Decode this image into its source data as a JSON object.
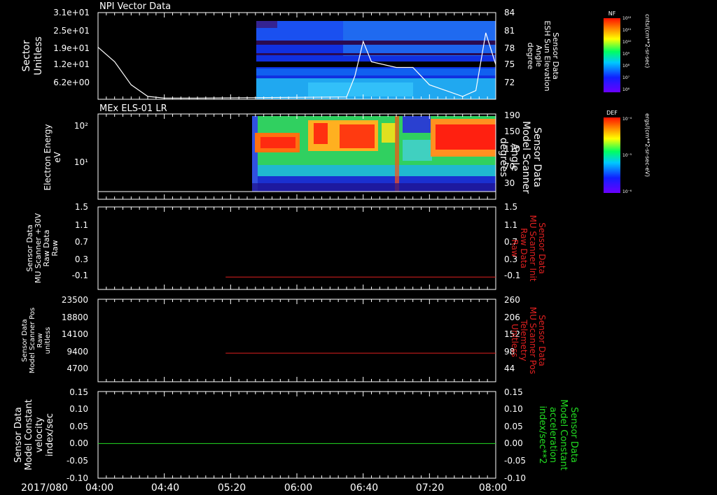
{
  "chart_data": [
    {
      "type": "heatmap",
      "title": "NPI Vector Data",
      "ylabel_left": [
        "Sector",
        "Unitless"
      ],
      "ylabel_right": [
        "Sensor Data",
        "ESH Sun Elevation",
        "Angle",
        "degree"
      ],
      "yticks_left": [
        "3.1e+01",
        "2.5e+01",
        "1.9e+01",
        "1.2e+01",
        "6.2e+00"
      ],
      "yticks_right": [
        "84",
        "81",
        "78",
        "75",
        "72"
      ],
      "colorbar": {
        "label": "NF",
        "unit": "cnts/(cm**2-sr-sec)",
        "ticks": [
          "10¹²",
          "10¹¹",
          "10¹⁰",
          "10⁹",
          "10⁸",
          "10⁷",
          "10⁶"
        ]
      },
      "line_series": {
        "name": "ESH Sun Elevation Angle",
        "x": [
          "04:00",
          "04:10",
          "04:20",
          "04:30",
          "04:40",
          "05:00",
          "06:30",
          "06:35",
          "06:40",
          "06:45",
          "07:00",
          "07:10",
          "07:20",
          "07:40",
          "07:48",
          "07:54",
          "08:00"
        ],
        "y": [
          78.0,
          75.5,
          71.5,
          69.5,
          69.2,
          69.2,
          69.4,
          73.0,
          79.0,
          75.5,
          74.5,
          74.5,
          71.5,
          69.5,
          70.5,
          80.5,
          75.0
        ],
        "ylim": [
          69,
          84
        ]
      }
    },
    {
      "type": "heatmap",
      "title": "MEx ELS-01 LR",
      "ylabel_left": [
        "Electron Energy",
        "eV"
      ],
      "ylabel_right": [
        "Sensor Data",
        "Model Scanner",
        "Angle",
        "degrees"
      ],
      "yticks_left": [
        "10²",
        "10¹"
      ],
      "yticks_right": [
        "190",
        "150",
        "110",
        "70",
        "30"
      ],
      "colorbar": {
        "label": "DEF",
        "unit": "ergs/(cm**2-sr-sec-eV)",
        "ticks": [
          "10⁻⁴",
          "10⁻⁵",
          "10⁻⁶"
        ]
      },
      "line_series": {
        "name": "Model Scanner Angle",
        "x": [
          "04:00",
          "08:00"
        ],
        "y": [
          10,
          10
        ],
        "ylim": [
          0,
          190
        ]
      }
    },
    {
      "type": "line",
      "ylabel_left": [
        "Sensor Data",
        "MU Scanner +30V",
        "Raw Data",
        "Raw"
      ],
      "ylabel_right": [
        "Sensor Data",
        "MU Scanner Init",
        "Raw Data",
        "Raw"
      ],
      "yticks": [
        "1.5",
        "1.1",
        "0.7",
        "0.3",
        "-0.1"
      ],
      "ylim": [
        -0.3,
        1.5
      ],
      "series": [
        {
          "name": "MU Scanner Init",
          "color": "#e02020",
          "x": [
            "05:17",
            "08:00"
          ],
          "y": [
            -0.03,
            -0.03
          ]
        }
      ]
    },
    {
      "type": "line",
      "ylabel_left": [
        "Sensor Data",
        "Model Scanner Pos",
        "Raw",
        "unitless"
      ],
      "ylabel_right": [
        "Sensor Data",
        "MU Scanner Pos",
        "Telemetry",
        "Unitless"
      ],
      "yticks_left": [
        "23500",
        "18800",
        "14100",
        "9400",
        "4700"
      ],
      "yticks_right": [
        "260",
        "206",
        "152",
        "98",
        "44"
      ],
      "ylim": [
        0,
        260
      ],
      "series": [
        {
          "name": "MU Scanner Pos",
          "color": "#e02020",
          "x": [
            "05:17",
            "08:00"
          ],
          "y": [
            90,
            90
          ]
        }
      ]
    },
    {
      "type": "line",
      "ylabel_left": [
        "Sensor Data",
        "Model Constant",
        "velocity",
        "index/sec"
      ],
      "ylabel_right": [
        "Sensor Data",
        "Model Constant",
        "acceleration",
        "index/sec**2"
      ],
      "yticks": [
        "0.15",
        "0.10",
        "0.05",
        "0.00",
        "-0.05",
        "-0.10"
      ],
      "ylim": [
        -0.1,
        0.15
      ],
      "series": [
        {
          "name": "Model Constant",
          "color": "#22dd22",
          "x": [
            "04:00",
            "08:00"
          ],
          "y": [
            0.0,
            0.0
          ]
        }
      ]
    }
  ],
  "x_axis": {
    "date_label": "2017/080",
    "ticks": [
      "04:00",
      "04:40",
      "05:20",
      "06:00",
      "06:40",
      "07:20",
      "08:00"
    ]
  },
  "colors": {
    "background": "#000000",
    "axes": "#ffffff",
    "red": "#e02020",
    "green": "#22dd22"
  }
}
